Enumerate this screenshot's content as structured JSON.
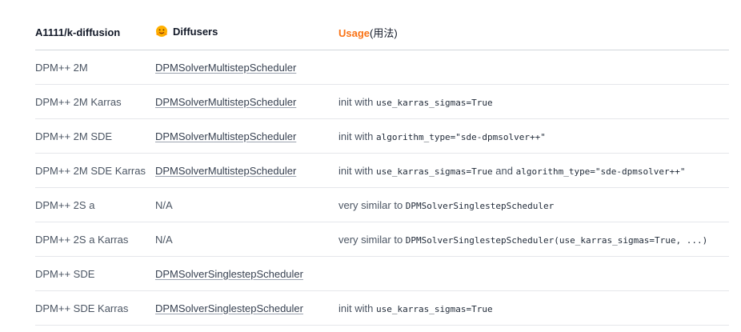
{
  "header": {
    "col1": "A1111/k-diffusion",
    "col2": "Diffusers",
    "col2_icon": "hugging-face-icon",
    "col3_word": "Usage",
    "col3_suffix": "(用法)",
    "accent_color": "#f97316"
  },
  "rows": [
    {
      "a1111": "DPM++ 2M",
      "diffusers": "DPMSolverMultistepScheduler",
      "usage": {
        "prefix": "",
        "code1": "",
        "mid": "",
        "code2": ""
      }
    },
    {
      "a1111": "DPM++ 2M Karras",
      "diffusers": "DPMSolverMultistepScheduler",
      "usage": {
        "prefix": "init with ",
        "code1": "use_karras_sigmas=True",
        "mid": "",
        "code2": ""
      }
    },
    {
      "a1111": "DPM++ 2M SDE",
      "diffusers": "DPMSolverMultistepScheduler",
      "usage": {
        "prefix": "init with ",
        "code1": "algorithm_type=\"sde-dpmsolver++\"",
        "mid": "",
        "code2": ""
      }
    },
    {
      "a1111": "DPM++ 2M SDE Karras",
      "diffusers": "DPMSolverMultistepScheduler",
      "usage": {
        "prefix": "init with ",
        "code1": "use_karras_sigmas=True",
        "mid": " and ",
        "code2": "algorithm_type=\"sde-dpmsolver++\""
      }
    },
    {
      "a1111": "DPM++ 2S a",
      "diffusers": "N/A",
      "usage": {
        "prefix": "very similar to ",
        "code1": "DPMSolverSinglestepScheduler",
        "mid": "",
        "code2": ""
      }
    },
    {
      "a1111": "DPM++ 2S a Karras",
      "diffusers": "N/A",
      "usage": {
        "prefix": "very similar to ",
        "code1": "DPMSolverSinglestepScheduler(use_karras_sigmas=True, ...)",
        "mid": "",
        "code2": ""
      }
    },
    {
      "a1111": "DPM++ SDE",
      "diffusers": "DPMSolverSinglestepScheduler",
      "usage": {
        "prefix": "",
        "code1": "",
        "mid": "",
        "code2": ""
      }
    },
    {
      "a1111": "DPM++ SDE Karras",
      "diffusers": "DPMSolverSinglestepScheduler",
      "usage": {
        "prefix": "init with ",
        "code1": "use_karras_sigmas=True",
        "mid": "",
        "code2": ""
      }
    }
  ]
}
